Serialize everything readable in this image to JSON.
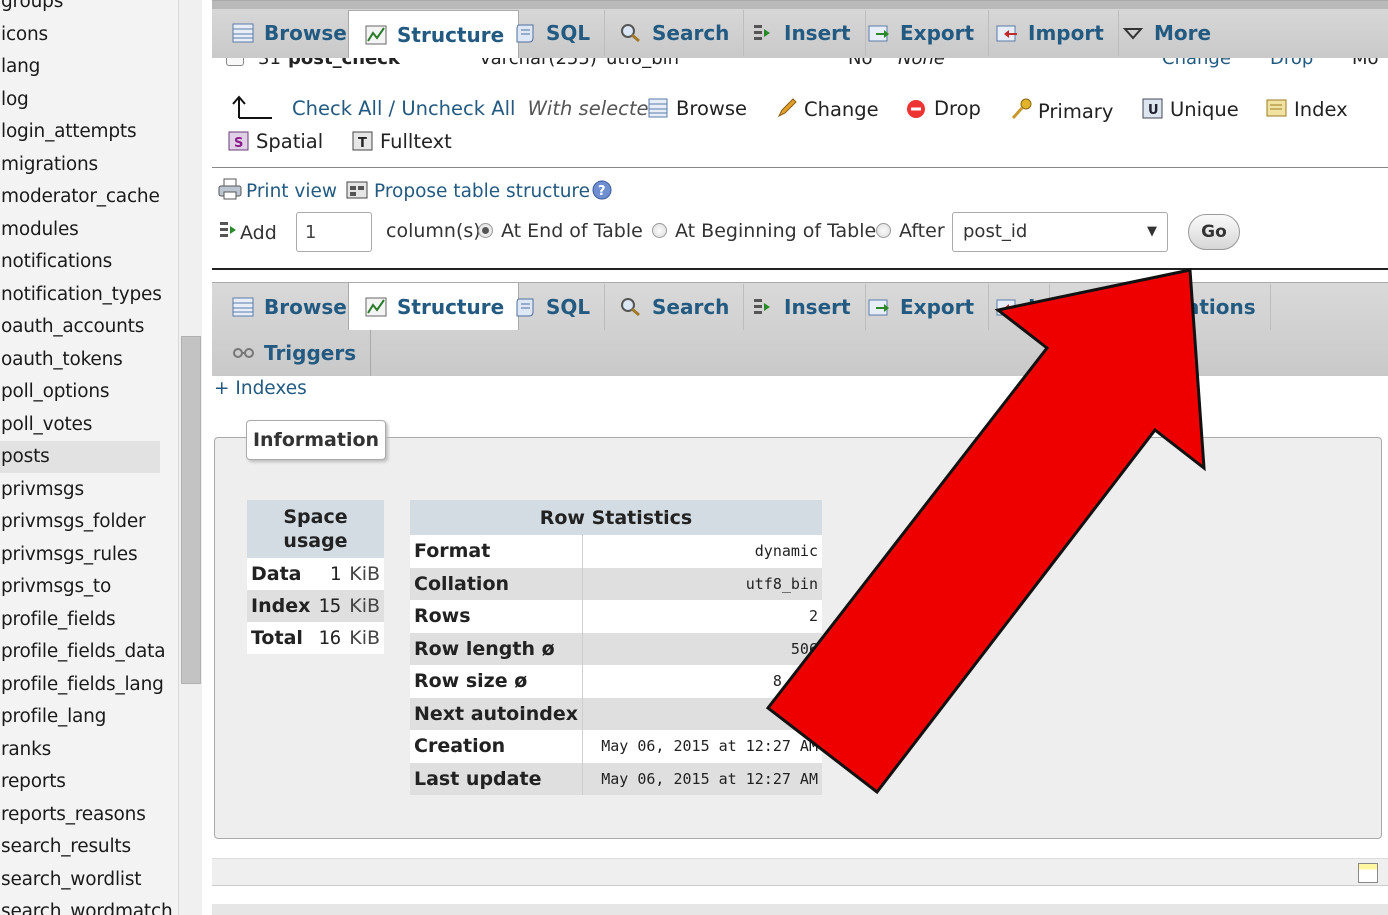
{
  "sidebar": {
    "tables": [
      "groups",
      "icons",
      "lang",
      "log",
      "login_attempts",
      "migrations",
      "moderator_cache",
      "modules",
      "notifications",
      "notification_types",
      "oauth_accounts",
      "oauth_tokens",
      "poll_options",
      "poll_votes",
      "posts",
      "privmsgs",
      "privmsgs_folder",
      "privmsgs_rules",
      "privmsgs_to",
      "profile_fields",
      "profile_fields_data",
      "profile_fields_lang",
      "profile_lang",
      "ranks",
      "reports",
      "reports_reasons",
      "search_results",
      "search_wordlist",
      "search_wordmatch"
    ],
    "active": "posts"
  },
  "top_tabs": [
    "Browse",
    "Structure",
    "SQL",
    "Search",
    "Insert",
    "Export",
    "Import",
    "More"
  ],
  "partial_row": {
    "num": "31",
    "name": "post_check",
    "type": "varchar(255)",
    "collation": "utf8_bin",
    "null": "No",
    "default": "None",
    "change": "Change",
    "drop": "Drop",
    "more": "Mo"
  },
  "with_selected": {
    "check_all": "Check All",
    "sep": " / ",
    "uncheck_all": "Uncheck All",
    "label": "With selected:",
    "actions": [
      "Browse",
      "Change",
      "Drop",
      "Primary",
      "Unique",
      "Index",
      "Spatial",
      "Fulltext"
    ]
  },
  "print_view": "Print view",
  "propose": "Propose table structure",
  "add_column": {
    "add": "Add",
    "count": "1",
    "columns_label": "column(s)",
    "at_end": "At End of Table",
    "at_beginning": "At Beginning of Table",
    "after": "After",
    "after_col": "post_id",
    "go": "Go"
  },
  "bottom_tabs": [
    "Browse",
    "Structure",
    "SQL",
    "Search",
    "Insert",
    "Export",
    "I",
    "rations"
  ],
  "triggers": "Triggers",
  "indexes": "+ Indexes",
  "information": {
    "legend": "Information",
    "space_usage": {
      "header_1": "Space",
      "header_2": "usage",
      "rows": [
        {
          "label": "Data",
          "value": "1",
          "unit": "KiB"
        },
        {
          "label": "Index",
          "value": "15",
          "unit": "KiB"
        },
        {
          "label": "Total",
          "value": "16",
          "unit": "KiB"
        }
      ]
    },
    "row_stats": {
      "header": "Row Statistics",
      "rows": [
        {
          "label": "Format",
          "value": "dynamic"
        },
        {
          "label": "Collation",
          "value": "utf8_bin"
        },
        {
          "label": "Rows",
          "value": "2"
        },
        {
          "label": "Row length ø",
          "value": "506"
        },
        {
          "label": "Row size ø",
          "value": "8,184"
        },
        {
          "label": "Next autoindex",
          "value": ""
        },
        {
          "label": "Creation",
          "value": "May 06, 2015 at 12:27 AM"
        },
        {
          "label": "Last update",
          "value": "May 06, 2015 at 12:27 AM"
        }
      ]
    }
  },
  "colors": {
    "link": "#235a81",
    "arrow_fill": "#ee0000",
    "tabbar": "#d0d0d0"
  }
}
